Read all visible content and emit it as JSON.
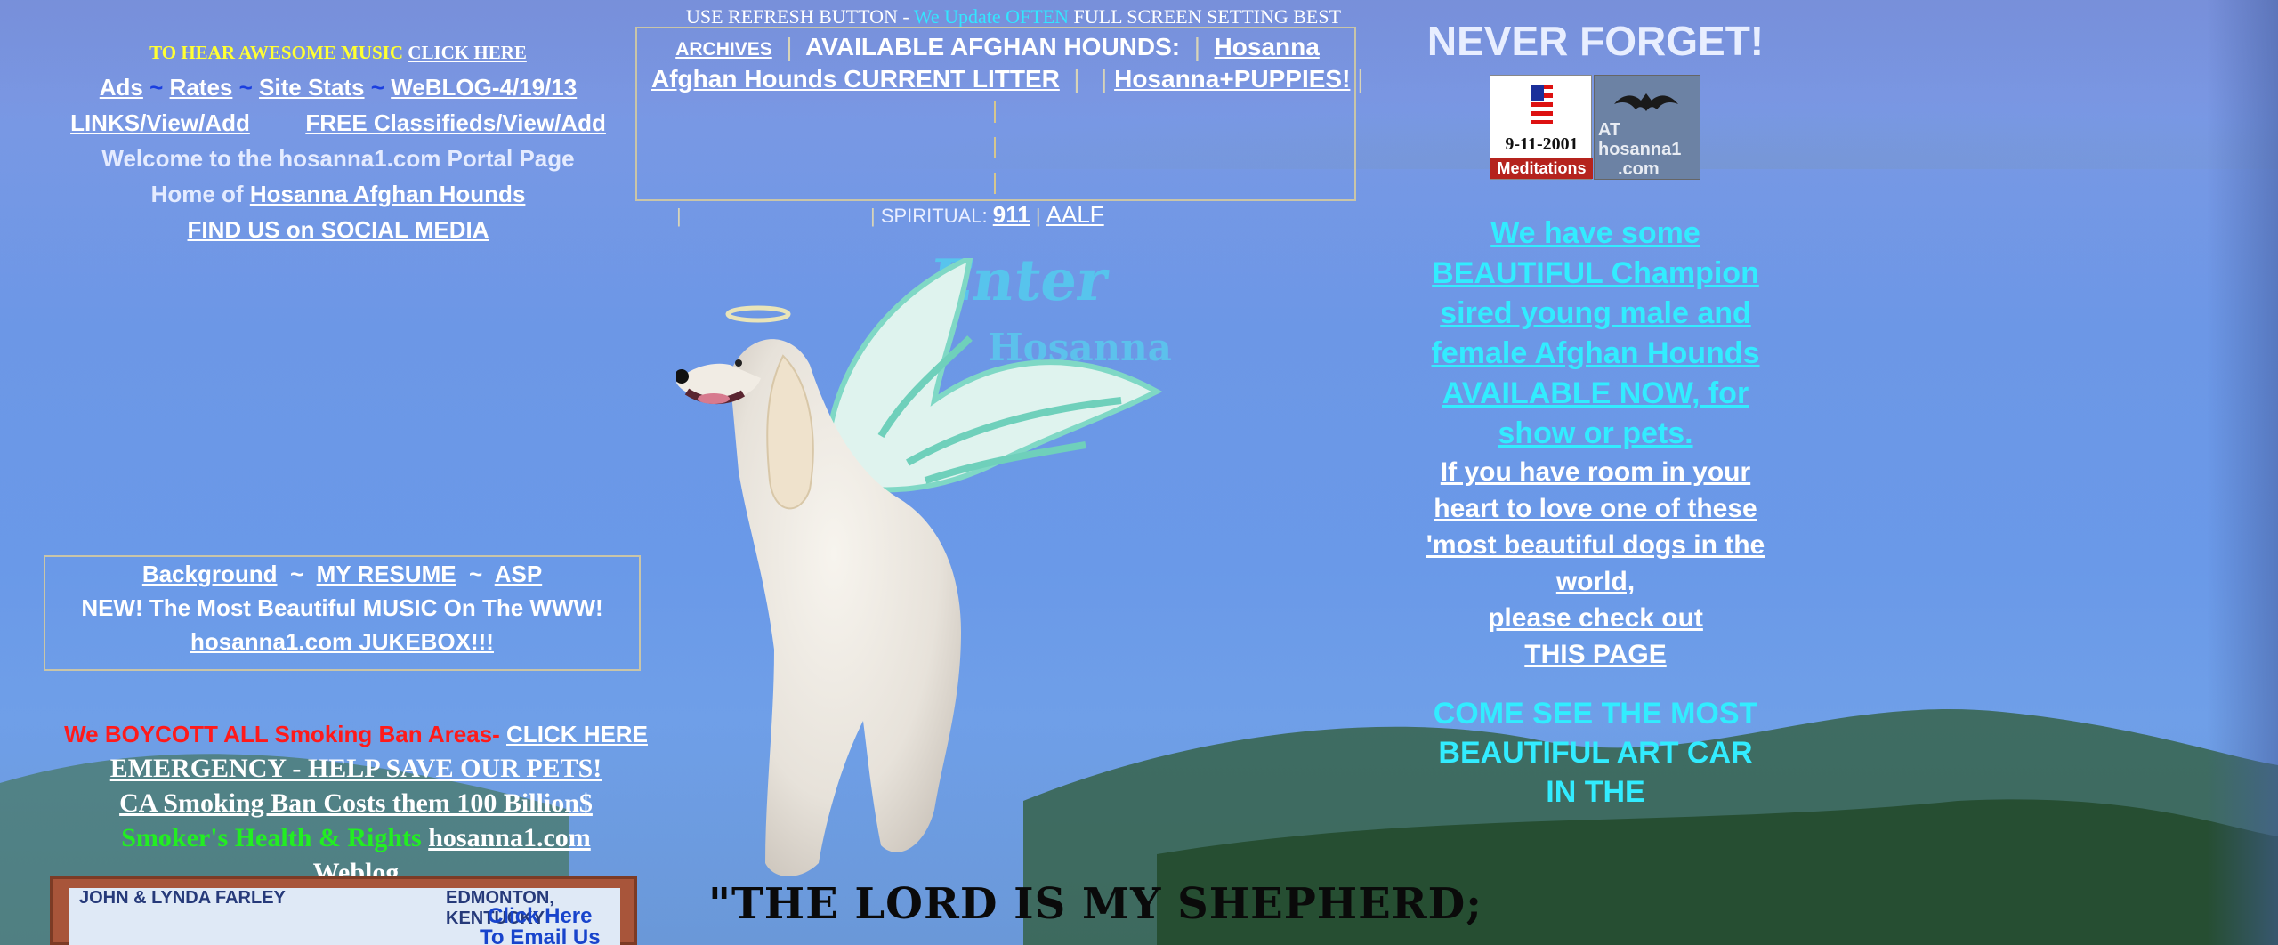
{
  "top_note": {
    "part1": "USE  REFRESH BUTTON - ",
    "part2": "We Update OFTEN",
    "part3": "  FULL SCREEN SETTING BEST"
  },
  "left": {
    "music_prefix": "TO HEAR AWESOME MUSIC ",
    "music_link": "CLICK HERE",
    "ads": "Ads",
    "rates": "Rates",
    "site_stats": "Site Stats",
    "weblog": "WeBLOG-4/19/13",
    "tilde": "~",
    "links": "LINKS/View/Add",
    "classifieds": "FREE Classifieds/View/Add",
    "welcome": "Welcome to the hosanna1.com Portal Page",
    "home_of": "Home of ",
    "hounds_link": "Hosanna Afghan Hounds",
    "social": "FIND US on SOCIAL MEDIA"
  },
  "left_box": {
    "background": "Background",
    "resume": "MY RESUME",
    "asp": "ASP",
    "tilde": "~",
    "music_line": "NEW! The Most Beautiful MUSIC On The WWW!",
    "jukebox": "hosanna1.com JUKEBOX!!!"
  },
  "boycott": {
    "red_text": "We BOYCOTT ALL Smoking Ban Areas- ",
    "click_here": "CLICK HERE",
    "emergency": "EMERGENCY - HELP SAVE OUR PETS!",
    "ca_ban": "CA Smoking Ban Costs them 100 Billion$",
    "health": "Smoker's Health & Rights",
    "hosanna_link": "hosanna1.com",
    "weblog": "Weblog"
  },
  "sign": {
    "names": "JOHN & LYNDA FARLEY",
    "location": "EDMONTON, KENTUCKY",
    "click": "Click Here",
    "email": "To Email Us"
  },
  "center_box": {
    "archives": "ARCHIVES",
    "available": "AVAILABLE AFGHAN HOUNDS:",
    "hosanna": "Hosanna",
    "current_litter": "Afghan Hounds CURRENT LITTER",
    "puppies": "Hosanna+PUPPIES!",
    "pipe": "|"
  },
  "spiritual": {
    "pipe": "|",
    "label": "SPIRITUAL: ",
    "link911": "911",
    "aalf": "AALF"
  },
  "enter_graphic": {
    "word1": "Enter",
    "word2": "Hosanna"
  },
  "shepherd": "\"THE LORD IS MY SHEPHERD;",
  "right": {
    "never_forget": "NEVER FORGET!",
    "img_date": "9-11-2001",
    "img_meditations": "Meditations",
    "img_at": "AT",
    "img_site": "hosanna1",
    "img_com": ".com",
    "beautiful_link": "We have some BEAUTIFUL Champion sired young male and female Afghan Hounds AVAILABLE NOW, for show or pets.",
    "room_link": "If you have room in your heart to love one of these 'most beautiful dogs in the world,",
    "check_link": "please check out",
    "this_page": "THIS PAGE",
    "come_see": "COME SEE THE MOST BEAUTIFUL ART CAR IN THE"
  },
  "colors": {
    "page_blue": "#6c97e6",
    "cyan": "#32ecff",
    "yellow": "#ffff33",
    "red": "#ff1a1a",
    "green": "#22ee22"
  }
}
